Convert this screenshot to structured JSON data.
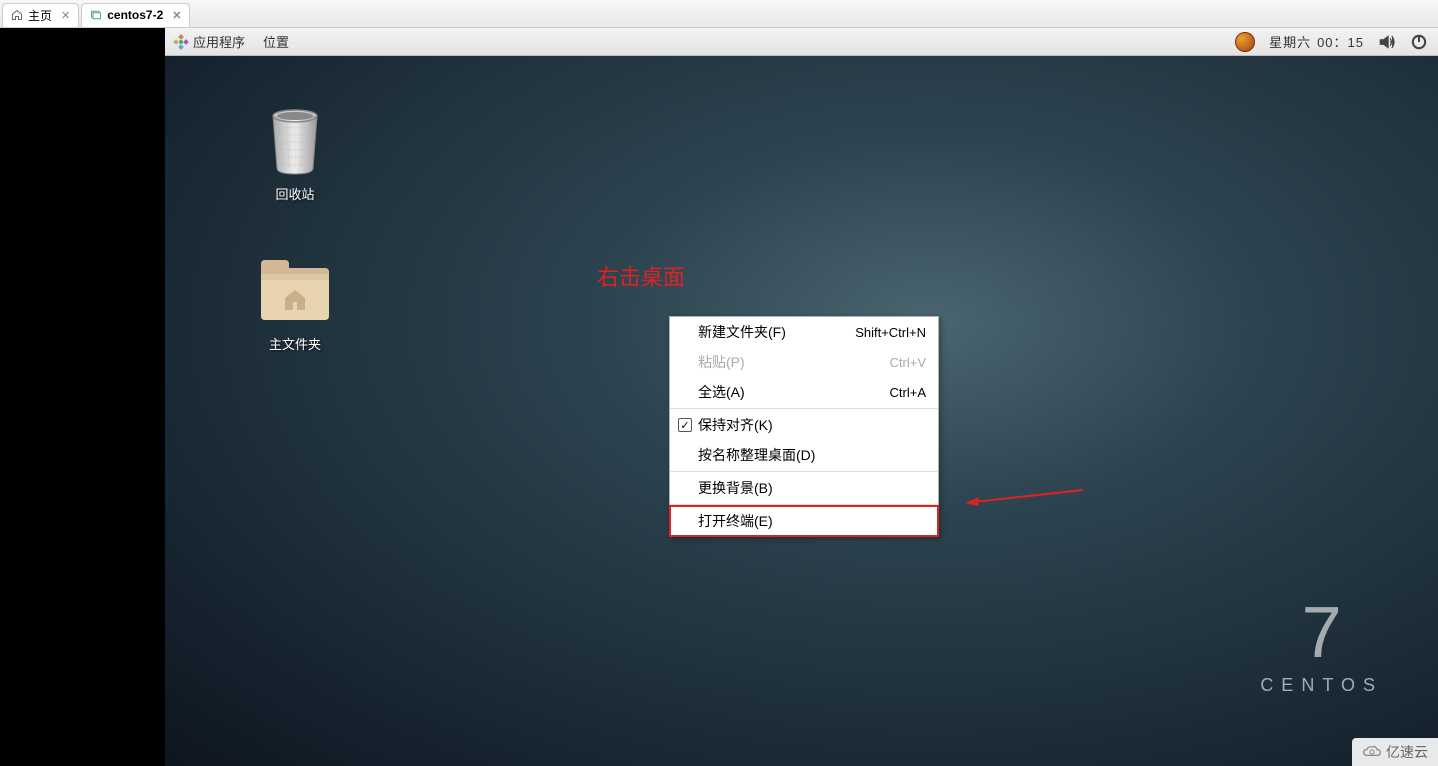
{
  "tabs": [
    {
      "label": "主页",
      "active": false
    },
    {
      "label": "centos7-2",
      "active": true
    }
  ],
  "panel": {
    "apps": "应用程序",
    "places": "位置",
    "day": "星期六",
    "time": "00：15"
  },
  "desktop_icons": {
    "trash": "回收站",
    "home": "主文件夹"
  },
  "annotation": "右击桌面",
  "context_menu": [
    {
      "label": "新建文件夹(F)",
      "shortcut": "Shift+Ctrl+N",
      "enabled": true
    },
    {
      "label": "粘贴(P)",
      "shortcut": "Ctrl+V",
      "enabled": false
    },
    {
      "label": "全选(A)",
      "shortcut": "Ctrl+A",
      "enabled": true
    },
    {
      "type": "divider"
    },
    {
      "label": "保持对齐(K)",
      "checked": true,
      "enabled": true
    },
    {
      "label": "按名称整理桌面(D)",
      "enabled": true
    },
    {
      "type": "divider"
    },
    {
      "label": "更换背景(B)",
      "enabled": true
    },
    {
      "type": "divider"
    },
    {
      "label": "打开终端(E)",
      "enabled": true,
      "highlighted": true
    }
  ],
  "centos": {
    "version": "7",
    "name": "CENTOS"
  },
  "watermark": "亿速云"
}
